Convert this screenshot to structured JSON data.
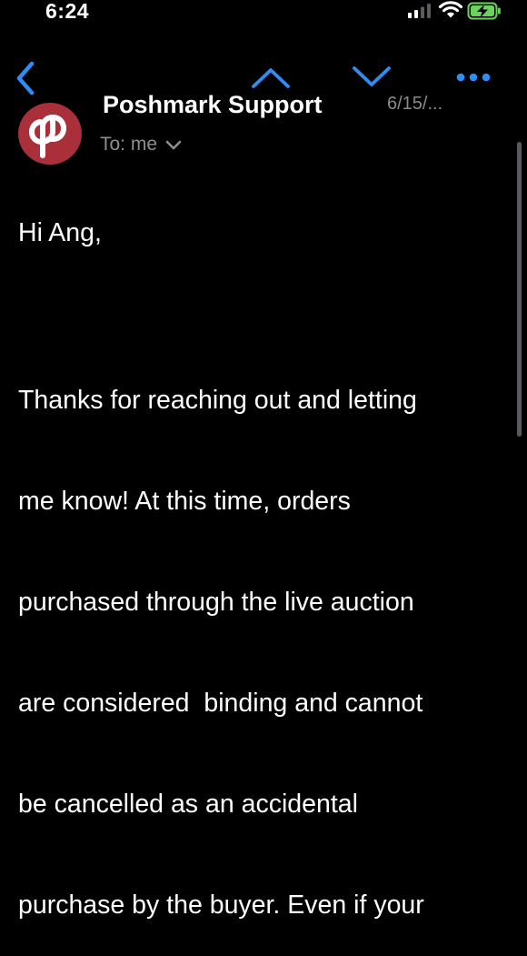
{
  "status_bar": {
    "time": "6:24"
  },
  "nav": {
    "back_icon": "chevron-left-icon",
    "prev_icon": "chevron-up-icon",
    "next_icon": "chevron-down-icon",
    "more_icon": "ellipsis-icon",
    "accent_color": "#2f8cf3"
  },
  "email": {
    "sender": "Poshmark Support",
    "date": "6/15/...",
    "to_label": "To: me",
    "avatar_color": "#a92f3a",
    "greeting": "Hi Ang,",
    "body_lines": [
      "Thanks for reaching out and letting",
      "me know! At this time, orders",
      "purchased through the live auction",
      "are considered  binding and cannot",
      "be cancelled as an accidental",
      "purchase by the buyer. Even if your"
    ]
  }
}
